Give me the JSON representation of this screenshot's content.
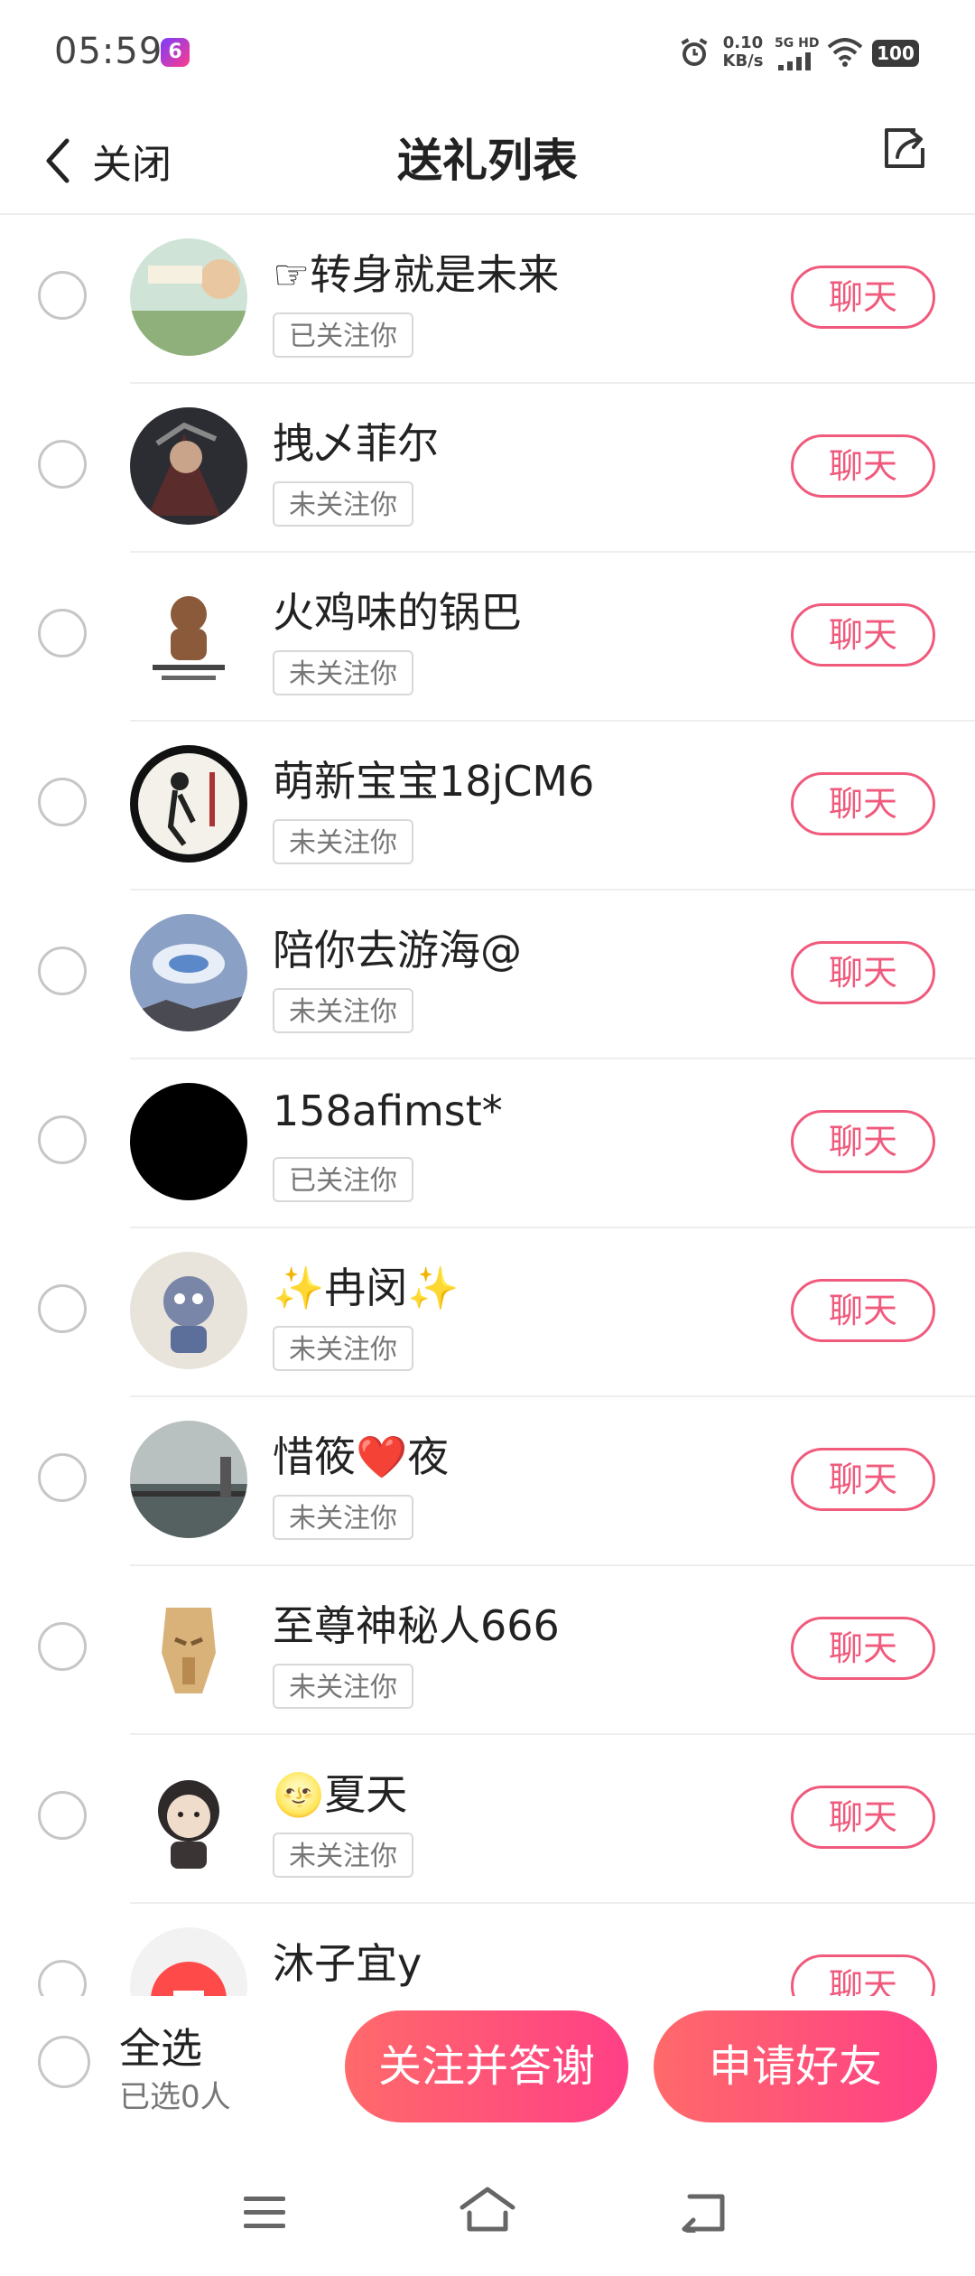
{
  "status_bar": {
    "time": "05:59",
    "app_badge": "6",
    "net_speed_value": "0.10",
    "net_speed_unit": "KB/s",
    "signal_label": "5G HD",
    "battery": "100",
    "icons": [
      "alarm-icon",
      "signal-icon",
      "wifi-icon",
      "battery-icon"
    ]
  },
  "header": {
    "back_label": "关闭",
    "title": "送礼列表",
    "icons": [
      "chevron-left-icon",
      "share-icon"
    ]
  },
  "list": {
    "chat_label": "聊天",
    "items": [
      {
        "name": "☞转身就是未来",
        "follow": "已关注你"
      },
      {
        "name": "拽乄菲尔",
        "follow": "未关注你"
      },
      {
        "name": "火鸡味的锅巴",
        "follow": "未关注你"
      },
      {
        "name": "萌新宝宝18jCM6",
        "follow": "未关注你"
      },
      {
        "name": "陪你去游海@",
        "follow": "未关注你"
      },
      {
        "name": "158afimst*",
        "follow": "已关注你"
      },
      {
        "name": "✨冉闵✨",
        "follow": "未关注你"
      },
      {
        "name": "惜筱❤️夜",
        "follow": "未关注你"
      },
      {
        "name": "至尊神秘人666",
        "follow": "未关注你"
      },
      {
        "name": "🌝夏天",
        "follow": "未关注你"
      },
      {
        "name": "沐子宜y",
        "follow": ""
      }
    ]
  },
  "bottom_bar": {
    "select_all": "全选",
    "selected_count": "已选0人",
    "follow_thanks": "关注并答谢",
    "add_friend": "申请好友"
  },
  "nav": {
    "icons": [
      "menu-icon",
      "home-icon",
      "back-icon"
    ]
  },
  "colors": {
    "accent": "#f05a7c",
    "gradient_start": "#ff6a6a",
    "gradient_end": "#ff3f86"
  }
}
